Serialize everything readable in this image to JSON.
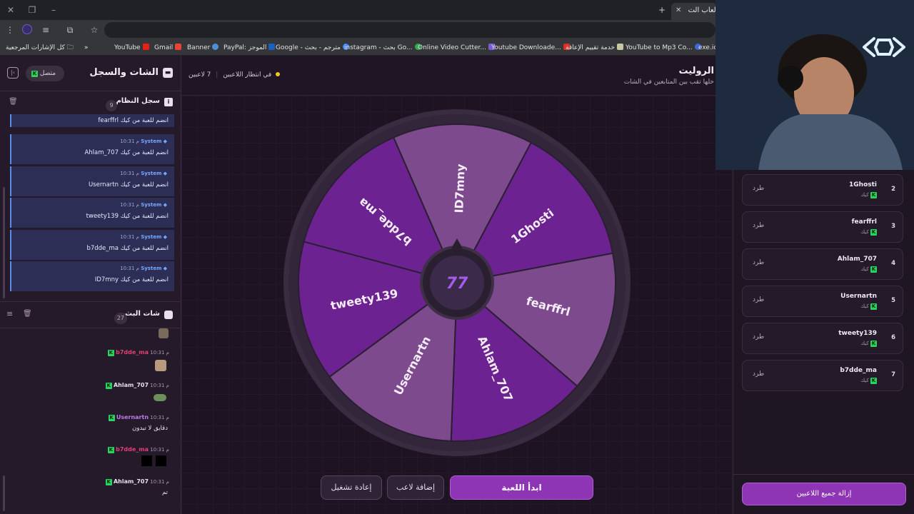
{
  "browser": {
    "tab_title": "الألعاب الت...",
    "bookmarks": [
      {
        "label": "كل الإشارات المرجعية"
      },
      {
        "label": "YouTube"
      },
      {
        "label": "Gmail"
      },
      {
        "label": "Banner"
      },
      {
        "label": "PayPal: الموجز"
      },
      {
        "label": "Google - مترجم - بحث"
      },
      {
        "label": "instagram - بحث Go..."
      },
      {
        "label": "Online Video Cutter..."
      },
      {
        "label": "Youtube Downloade..."
      },
      {
        "label": "خدمة تقييم الإعاقة"
      },
      {
        "label": "YouTube to Mp3 Co..."
      },
      {
        "label": "exe.io"
      }
    ]
  },
  "left_panel": {
    "title": "الشات والسجل",
    "status": "متصل",
    "system_log": {
      "title": "سجل النظام",
      "count": "9",
      "first_text": "fearffrl انضم للعبة من كيك",
      "entries": [
        {
          "sender": "System",
          "time": "10:31 م",
          "text": "Ahlam_707 انضم للعبة من كيك"
        },
        {
          "sender": "System",
          "time": "10:31 م",
          "text": "Usernartn انضم للعبة من كيك"
        },
        {
          "sender": "System",
          "time": "10:31 م",
          "text": "tweety139 انضم للعبة من كيك"
        },
        {
          "sender": "System",
          "time": "10:31 م",
          "text": "b7dde_ma انضم للعبة من كيك"
        },
        {
          "sender": "System",
          "time": "10:31 م",
          "text": "ID7mny انضم للعبة من كيك"
        }
      ]
    },
    "stream_chat": {
      "title": "شات البث",
      "count": "27",
      "messages": [
        {
          "user": "b7dde_ma",
          "time": "10:31 م",
          "text": "",
          "color": "#e0407a"
        },
        {
          "user": "Ahlam_707",
          "time": "10:31 م",
          "text": "",
          "color": "#e8e0ee"
        },
        {
          "user": "Usernartn",
          "time": "10:31 م",
          "text": "دقايق لا تبدون",
          "color": "#c07ae8"
        },
        {
          "user": "b7dde_ma",
          "time": "10:31 م",
          "text": "",
          "color": "#e0407a"
        },
        {
          "user": "Ahlam_707",
          "time": "10:31 م",
          "text": "تم",
          "color": "#e8e0ee"
        }
      ]
    }
  },
  "center": {
    "title": "الروليت",
    "subtitle": "خلها تقب بين المتابعين في الشات",
    "players_count": "7 لاعبين",
    "waiting": "في انتظار اللاعبين",
    "wheel_names": [
      "b7dde_ma",
      "ID7mny",
      "1Ghosti",
      "fearffrl",
      "Ahlam_707",
      "Usernartn",
      "tweety139"
    ],
    "buttons": {
      "start": "ابدأ اللعبة",
      "add_player": "إضافة لاعب",
      "restart": "إعادة تشغيل"
    }
  },
  "right_panel": {
    "players": [
      {
        "rank": "2",
        "name": "1Ghosti",
        "platform": "كيك",
        "kick": "طرد"
      },
      {
        "rank": "3",
        "name": "fearffrl",
        "platform": "كيك",
        "kick": "طرد"
      },
      {
        "rank": "4",
        "name": "Ahlam_707",
        "platform": "كيك",
        "kick": "طرد"
      },
      {
        "rank": "5",
        "name": "Usernartn",
        "platform": "كيك",
        "kick": "طرد"
      },
      {
        "rank": "6",
        "name": "tweety139",
        "platform": "كيك",
        "kick": "طرد"
      },
      {
        "rank": "7",
        "name": "b7dde_ma",
        "platform": "كيك",
        "kick": "طرد"
      }
    ],
    "remove_all": "إزالة جميع اللاعبين"
  },
  "colors": {
    "accent": "#9b3fc4",
    "wheel_dark": "#6c2290",
    "wheel_light": "#7e4a8e",
    "kick_green": "#2bd35c"
  }
}
